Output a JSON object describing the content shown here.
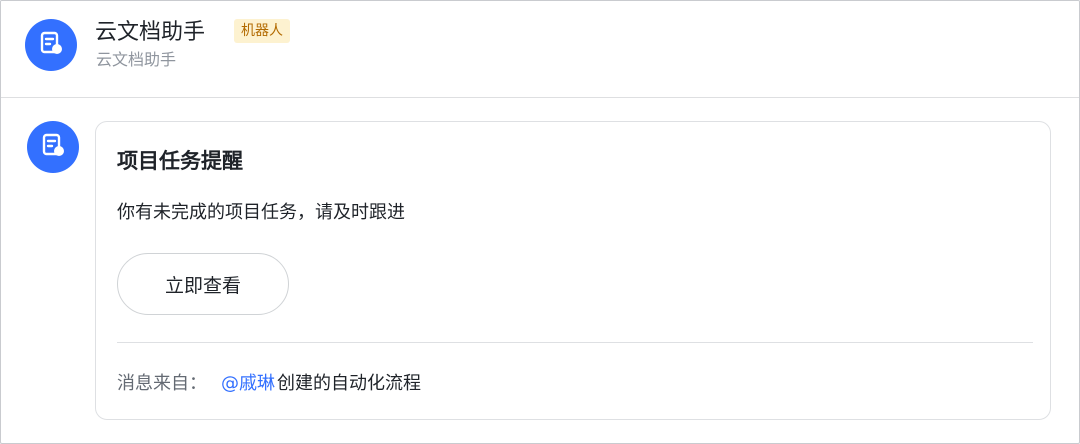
{
  "header": {
    "bot_name": "云文档助手",
    "bot_badge": "机器人",
    "bot_subtitle": "云文档助手",
    "avatar_icon": "doc-assistant-icon"
  },
  "message": {
    "avatar_icon": "doc-assistant-icon",
    "card": {
      "title": "项目任务提醒",
      "text": "你有未完成的项目任务，请及时跟进",
      "button_label": "立即查看",
      "footer_prefix": "消息来自：",
      "footer_mention": "@戚琳",
      "footer_suffix": "创建的自动化流程"
    }
  },
  "colors": {
    "accent": "#3370ff",
    "badge_bg": "#fdf2d0",
    "badge_text": "#b26a00"
  }
}
